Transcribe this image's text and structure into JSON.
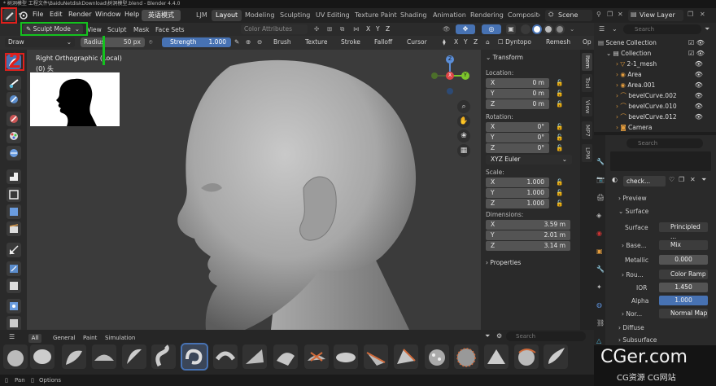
{
  "window_title": "* 树洞模型 工程文件\\BaiduNetdiskDownload\\树洞模型.blend - Blender 4.4.0",
  "menu": [
    "File",
    "Edit",
    "Render",
    "Window",
    "Help"
  ],
  "language_button": "英语模式",
  "workspaces": [
    "LJM",
    "Layout",
    "Modeling",
    "Sculpting",
    "UV Editing",
    "Texture Paint",
    "Shading",
    "Animation",
    "Rendering",
    "Composit"
  ],
  "active_workspace": "Layout",
  "scene": "Scene",
  "view_layer": "View Layer",
  "header": {
    "mode": "Sculpt Mode",
    "menus": [
      "View",
      "Sculpt",
      "Mask",
      "Face Sets"
    ],
    "color_attributes": "Color Attributes",
    "axes": [
      "X",
      "Y",
      "Z"
    ]
  },
  "tool_settings": {
    "brush": "Draw",
    "radius_label": "Radius",
    "radius_value": "50 px",
    "strength_label": "Strength",
    "strength_value": "1.000",
    "dropdowns": [
      "Brush",
      "Texture",
      "Stroke",
      "Falloff",
      "Cursor"
    ],
    "axes": [
      "X",
      "Y",
      "Z"
    ],
    "dyntopo": "Dyntopo",
    "remesh": "Remesh",
    "options": "Op"
  },
  "viewport": {
    "view_name": "Right Orthographic (Local)",
    "object_label": "(0) 头",
    "gizmo": [
      "Z",
      "Y",
      "X"
    ]
  },
  "npanel": {
    "title": "Transform",
    "location_label": "Location:",
    "location": [
      {
        "axis": "X",
        "value": "0 m"
      },
      {
        "axis": "Y",
        "value": "0 m"
      },
      {
        "axis": "Z",
        "value": "0 m"
      }
    ],
    "rotation_label": "Rotation:",
    "rotation": [
      {
        "axis": "X",
        "value": "0°"
      },
      {
        "axis": "Y",
        "value": "0°"
      },
      {
        "axis": "Z",
        "value": "0°"
      }
    ],
    "rotation_mode": "XYZ Euler",
    "scale_label": "Scale:",
    "scale": [
      {
        "axis": "X",
        "value": "1.000"
      },
      {
        "axis": "Y",
        "value": "1.000"
      },
      {
        "axis": "Z",
        "value": "1.000"
      }
    ],
    "dimensions_label": "Dimensions:",
    "dimensions": [
      {
        "axis": "X",
        "value": "3.59 m"
      },
      {
        "axis": "Y",
        "value": "2.01 m"
      },
      {
        "axis": "Z",
        "value": "3.14 m"
      }
    ],
    "properties": "Properties",
    "tabs": [
      "Item",
      "Tool",
      "View",
      "MP7",
      "LPM"
    ]
  },
  "outliner": {
    "search_placeholder": "Search",
    "rows": [
      {
        "name": "Scene Collection",
        "level": 0
      },
      {
        "name": "Collection",
        "level": 1
      },
      {
        "name": "2-1_mesh",
        "level": 2
      },
      {
        "name": "Area",
        "level": 2
      },
      {
        "name": "Area.001",
        "level": 2
      },
      {
        "name": "bevelCurve.002",
        "level": 2
      },
      {
        "name": "bevelCurve.010",
        "level": 2
      },
      {
        "name": "bevelCurve.012",
        "level": 2
      },
      {
        "name": "Camera",
        "level": 2
      }
    ]
  },
  "properties": {
    "search_placeholder": "Search",
    "material": "check...",
    "preview": "Preview",
    "surface": "Surface",
    "rows": [
      {
        "label": "Surface",
        "value": "Principled ..."
      },
      {
        "label": "Base...",
        "value": "Mix"
      },
      {
        "label": "Metallic",
        "value": "0.000"
      },
      {
        "label": "Rou...",
        "value": "Color Ramp"
      },
      {
        "label": "IOR",
        "value": "1.450"
      },
      {
        "label": "Alpha",
        "value": "1.000"
      },
      {
        "label": "Nor...",
        "value": "Normal Map"
      }
    ],
    "diffuse": "Diffuse",
    "subsurface": "Subsurface"
  },
  "brush_asset_shelf": {
    "tabs": [
      "All",
      "General",
      "Paint",
      "Simulation"
    ],
    "search_placeholder": "Search"
  },
  "status_bar": {
    "pan": "Pan",
    "options": "Options"
  },
  "watermark": {
    "main": "CGer.com",
    "sub": "CG资源  CG网站"
  },
  "annotations": {
    "number": "2"
  },
  "colors": {
    "accent": "#4772b3",
    "annotation_red": "#e0201c",
    "annotation_green": "#14c21e"
  }
}
